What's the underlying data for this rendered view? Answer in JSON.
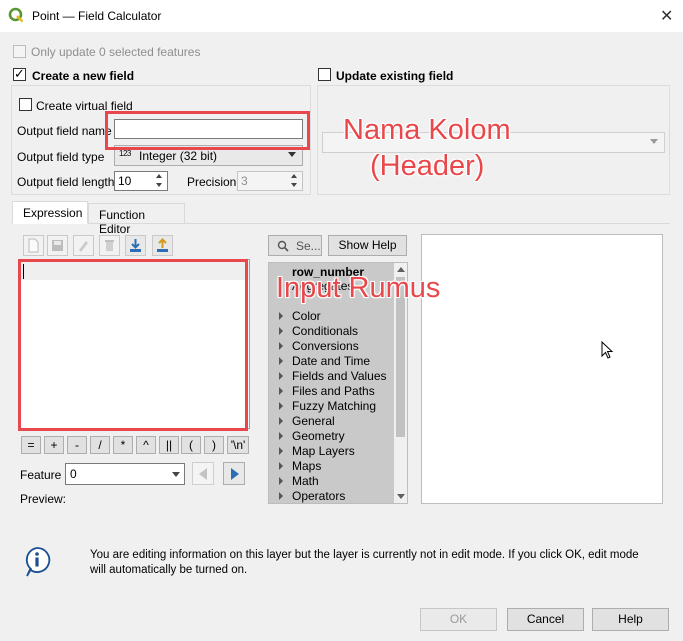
{
  "window": {
    "title": "Point — Field Calculator",
    "close": "✕"
  },
  "only_update": {
    "label": "Only update 0 selected features",
    "checked": false,
    "enabled": false
  },
  "create_new_field": {
    "label": "Create a new field",
    "checked": true,
    "create_virtual": {
      "label": "Create virtual field",
      "checked": false
    },
    "output_name": {
      "label": "Output field name",
      "value": ""
    },
    "output_type": {
      "label": "Output field type",
      "value": "Integer (32 bit)",
      "badge": "123"
    },
    "output_length": {
      "label": "Output field length",
      "value": "10"
    },
    "precision": {
      "label": "Precision",
      "value": "3"
    }
  },
  "update_existing": {
    "label": "Update existing field",
    "checked": false
  },
  "tabs": [
    {
      "label": "Expression",
      "active": true
    },
    {
      "label": "Function Editor",
      "active": false
    }
  ],
  "search": {
    "placeholder": "Se..."
  },
  "show_help": "Show Help",
  "operators": [
    "=",
    "+",
    "-",
    "/",
    "*",
    "^",
    "||",
    "(",
    ")",
    "'\\n'"
  ],
  "feature": {
    "label": "Feature",
    "value": "0"
  },
  "preview": {
    "label": "Preview:"
  },
  "functions": {
    "header": "row_number",
    "items": [
      "Aggregates",
      "Color",
      "Conditionals",
      "Conversions",
      "Date and Time",
      "Fields and Values",
      "Files and Paths",
      "Fuzzy Matching",
      "General",
      "Geometry",
      "Map Layers",
      "Maps",
      "Math",
      "Operators"
    ]
  },
  "info": {
    "message": "You are editing information on this layer but the layer is currently not in edit mode. If you click OK, edit mode will automatically be turned on."
  },
  "buttons": {
    "ok": "OK",
    "cancel": "Cancel",
    "help": "Help"
  },
  "annotations": {
    "nama_kolom_line1": "Nama Kolom",
    "nama_kolom_line2": "(Header)",
    "input_rumus": "Input Rumus"
  },
  "colors": {
    "annotation": "#e8484b",
    "qgis_green": "#589632"
  }
}
